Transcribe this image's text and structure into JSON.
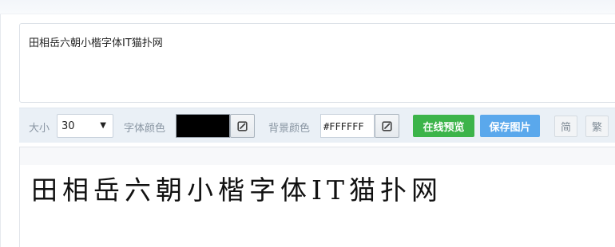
{
  "input": {
    "text": "田相岳六朝小楷字体IT猫扑网"
  },
  "toolbar": {
    "size_label": "大小",
    "size_value": "30",
    "size_caret": "▼",
    "font_color_label": "字体颜色",
    "font_color": "#000000",
    "bg_color_label": "背景颜色",
    "bg_color_value": "#FFFFFF",
    "preview_online_label": "在线预览",
    "save_image_label": "保存图片",
    "simplified_label": "简",
    "traditional_label": "繁",
    "picker_icon": "color-picker-icon"
  },
  "preview": {
    "text": "田相岳六朝小楷字体IT猫扑网"
  },
  "colors": {
    "primary_green": "#3cb44a",
    "primary_blue": "#5aa8ec",
    "toolbar_bg": "#eaf0f6"
  }
}
